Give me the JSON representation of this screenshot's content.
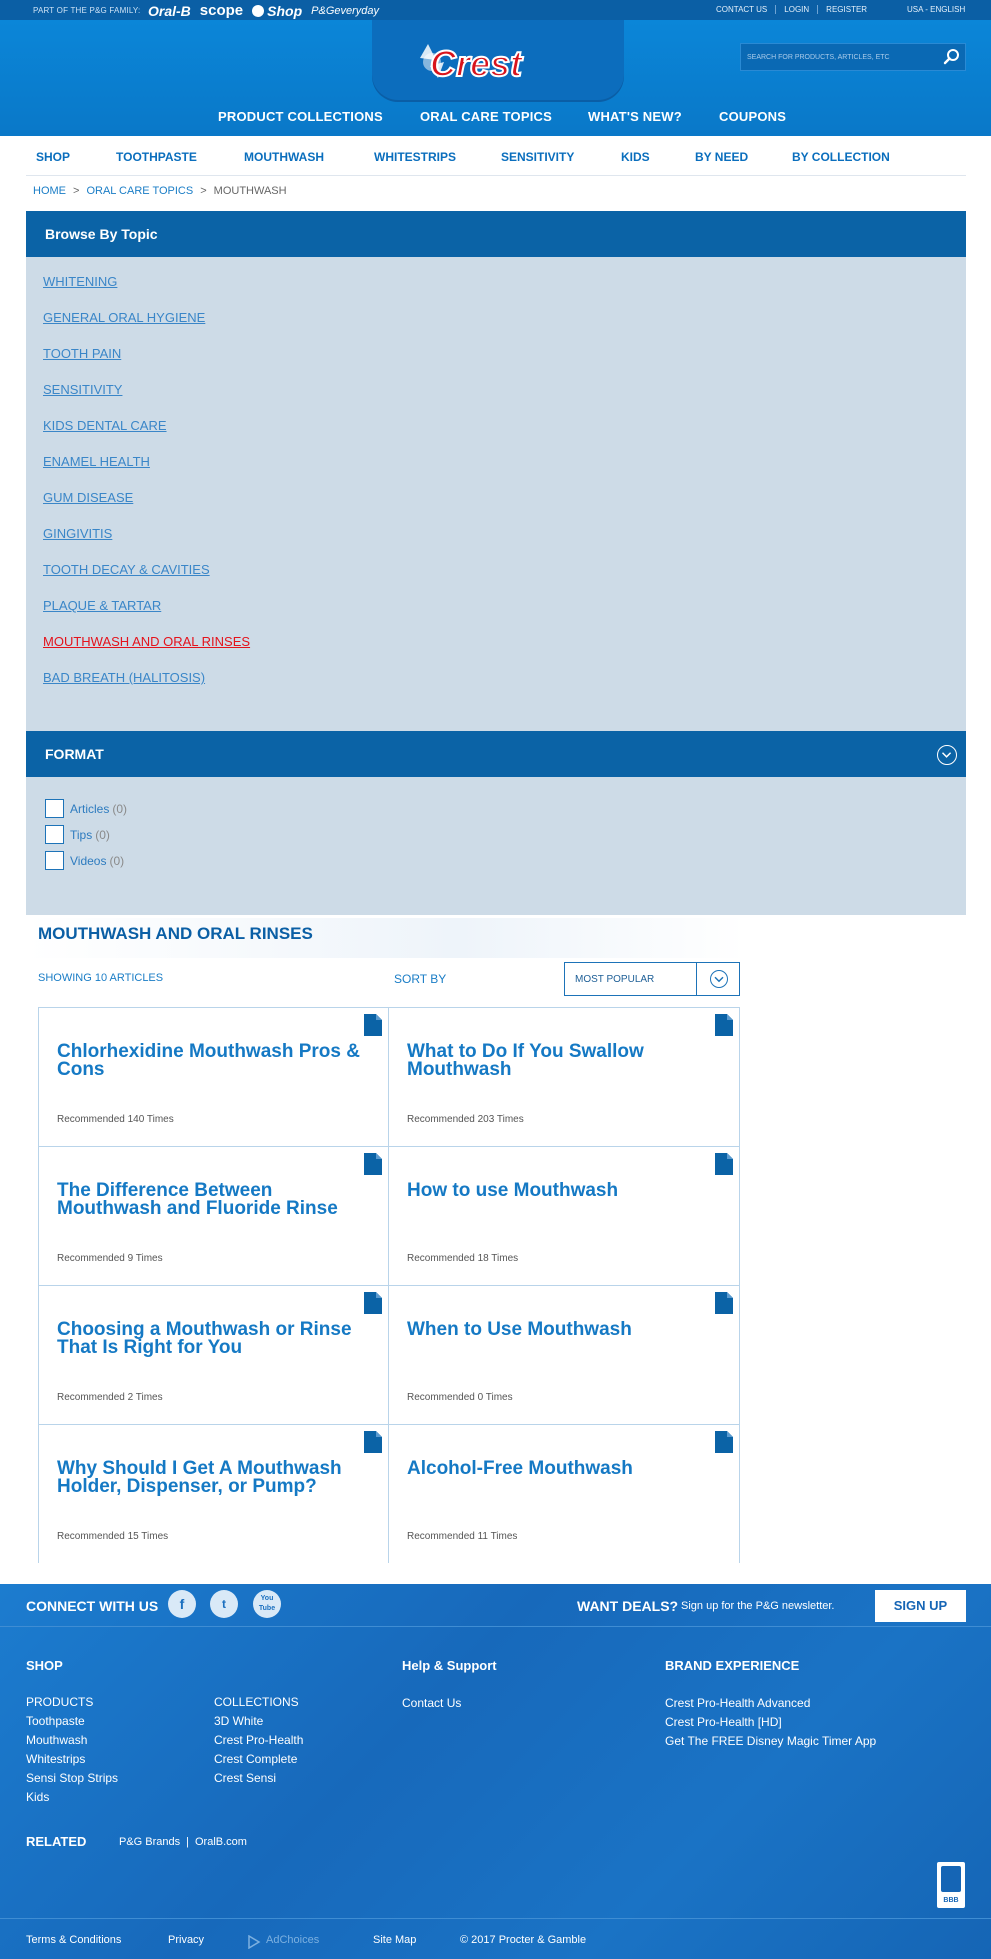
{
  "topbar": {
    "family_label": "PART OF THE P&G FAMILY:",
    "brands": [
      "Oral-B",
      "scope",
      "Shop",
      "P&Geveryday"
    ],
    "utility_links": [
      "CONTACT US",
      "LOGIN",
      "REGISTER"
    ],
    "locale": "USA - ENGLISH"
  },
  "header": {
    "logo_text": "Crest",
    "search_placeholder": "SEARCH FOR PRODUCTS, ARTICLES, ETC",
    "main_nav": [
      "PRODUCT COLLECTIONS",
      "ORAL CARE TOPICS",
      "WHAT'S NEW?",
      "COUPONS"
    ]
  },
  "subnav": [
    "SHOP",
    "TOOTHPASTE",
    "MOUTHWASH",
    "WHITESTRIPS",
    "SENSITIVITY",
    "KIDS",
    "BY NEED",
    "BY COLLECTION"
  ],
  "breadcrumb": [
    "HOME",
    "ORAL CARE TOPICS",
    "MOUTHWASH"
  ],
  "browse": {
    "heading": "Browse By Topic",
    "topics": [
      "WHITENING",
      "GENERAL ORAL HYGIENE",
      "TOOTH PAIN",
      "SENSITIVITY",
      "KIDS DENTAL CARE",
      "ENAMEL HEALTH",
      "GUM DISEASE",
      "GINGIVITIS",
      "TOOTH DECAY & CAVITIES",
      "PLAQUE & TARTAR",
      "MOUTHWASH AND ORAL RINSES",
      "BAD BREATH (HALITOSIS)"
    ],
    "active_topic": "MOUTHWASH AND ORAL RINSES",
    "format_heading": "FORMAT",
    "filters": [
      {
        "label": "Articles",
        "count": "(0)"
      },
      {
        "label": "Tips",
        "count": "(0)"
      },
      {
        "label": "Videos",
        "count": "(0)"
      }
    ]
  },
  "listing": {
    "title": "MOUTHWASH AND ORAL RINSES",
    "showing": "SHOWING 10 ARTICLES",
    "sort_label": "SORT BY",
    "sort_value": "MOST POPULAR",
    "articles": [
      {
        "title": "Chlorhexidine Mouthwash Pros & Cons",
        "recommended": "Recommended 140 Times"
      },
      {
        "title": "What to Do If You Swallow Mouthwash",
        "recommended": "Recommended 203 Times"
      },
      {
        "title": "The Difference Between Mouthwash and Fluoride Rinse",
        "recommended": "Recommended 9 Times"
      },
      {
        "title": "How to use Mouthwash",
        "recommended": "Recommended 18 Times"
      },
      {
        "title": "Choosing a Mouthwash or Rinse That Is Right for You",
        "recommended": "Recommended 2 Times"
      },
      {
        "title": "When to Use Mouthwash",
        "recommended": "Recommended 0 Times"
      },
      {
        "title": "Why Should I Get A Mouthwash Holder, Dispenser, or Pump?",
        "recommended": "Recommended 15 Times"
      },
      {
        "title": "Alcohol-Free Mouthwash",
        "recommended": "Recommended 11 Times"
      }
    ]
  },
  "footer": {
    "connect_label": "CONNECT WITH US",
    "social": [
      "f",
      "t",
      "You Tube"
    ],
    "deals_label": "WANT DEALS?",
    "deals_sub": "Sign up for the P&G newsletter.",
    "signup_label": "SIGN UP",
    "shop_heading": "SHOP",
    "shop_col1": [
      "PRODUCTS",
      "Toothpaste",
      "Mouthwash",
      "Whitestrips",
      "Sensi Stop Strips",
      "Kids"
    ],
    "shop_col2": [
      "COLLECTIONS",
      "3D White",
      "Crest Pro-Health",
      "Crest Complete",
      "Crest Sensi"
    ],
    "help_heading": "Help & Support",
    "help_links": [
      "Contact Us"
    ],
    "brand_heading": "BRAND EXPERIENCE",
    "brand_links": [
      "Crest Pro-Health Advanced",
      "Crest Pro-Health [HD]",
      "Get The FREE Disney Magic Timer App"
    ],
    "related_label": "RELATED",
    "related_links": [
      "P&G Brands",
      "OralB.com"
    ],
    "bottom_links": [
      "Terms & Conditions",
      "Privacy",
      "AdChoices",
      "Site Map",
      "© 2017 Procter & Gamble"
    ],
    "bbb_label": "BBB"
  },
  "colors": {
    "brand_blue": "#0a7fd1",
    "panel_blue": "#0b63a6",
    "link_blue": "#1579c4",
    "active_red": "#e4121b"
  }
}
